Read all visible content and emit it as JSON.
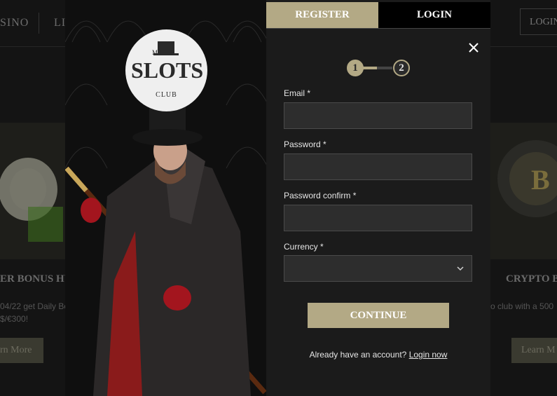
{
  "background": {
    "nav": {
      "item_casino": "SINO",
      "item_live": "LI",
      "login_label": "LOGIN"
    },
    "left_card": {
      "title": "ER BONUS HU",
      "text_line1": "04/22 get Daily Bo",
      "text_line2": "$/€300!",
      "button_label": "rn More"
    },
    "right_card": {
      "title": "CRYPTO B",
      "text_line1": "o club with a 500",
      "button_label": "Learn M"
    }
  },
  "logo": {
    "small_text": "MR",
    "main_text": "SLOTS",
    "sub_text": "CLUB"
  },
  "modal": {
    "tabs": {
      "register_label": "REGISTER",
      "login_label": "LOGIN"
    },
    "steps": {
      "step1": "1",
      "step2": "2"
    },
    "fields": {
      "email_label": "Email *",
      "password_label": "Password *",
      "password_confirm_label": "Password confirm *",
      "currency_label": "Currency *"
    },
    "values": {
      "email": "",
      "password": "",
      "password_confirm": "",
      "currency": ""
    },
    "continue_label": "CONTINUE",
    "footer": {
      "prompt": "Already have an account?",
      "link": "Login now"
    }
  },
  "colors": {
    "accent": "#b3a985",
    "panel": "#1b1b1b",
    "input_bg": "#2d2d2d"
  },
  "icons": {
    "close": "close-icon",
    "dropdown": "chevron-down-icon"
  }
}
